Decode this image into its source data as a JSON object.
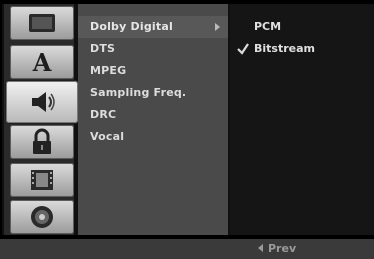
{
  "sidebar": {
    "icons": [
      {
        "name": "disc-settings-icon"
      },
      {
        "name": "language-icon",
        "glyph": "A"
      },
      {
        "name": "audio-icon"
      },
      {
        "name": "lock-icon"
      },
      {
        "name": "video-icon"
      },
      {
        "name": "others-disc-icon"
      }
    ],
    "active_index": 2
  },
  "menu": {
    "items": [
      {
        "label": "Dolby Digital",
        "selected": true
      },
      {
        "label": "DTS"
      },
      {
        "label": "MPEG"
      },
      {
        "label": "Sampling Freq."
      },
      {
        "label": "DRC"
      },
      {
        "label": "Vocal"
      }
    ]
  },
  "options": {
    "items": [
      {
        "label": "PCM",
        "checked": false
      },
      {
        "label": "Bitstream",
        "checked": true
      }
    ]
  },
  "footer": {
    "prev_label": "Prev"
  },
  "colors": {
    "background": "#000000",
    "menu_panel": "#4a4a4a",
    "menu_highlight": "#585858",
    "text": "#dddddd"
  }
}
